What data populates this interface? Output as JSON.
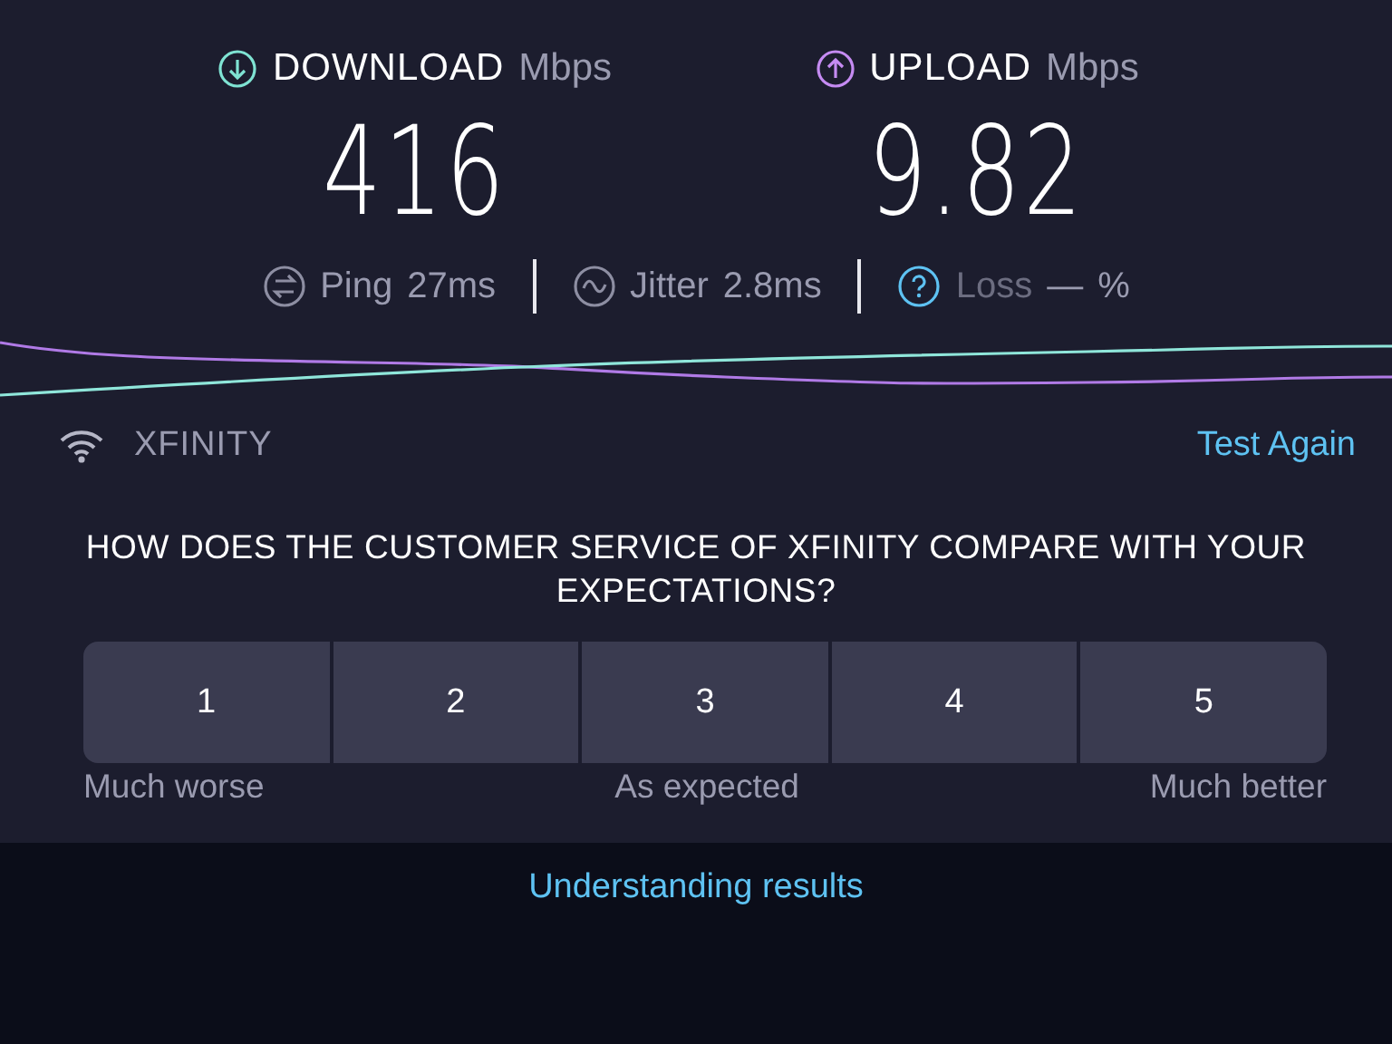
{
  "results": [
    {
      "kind": "download",
      "label": "DOWNLOAD",
      "unit": "Mbps",
      "value": "416"
    },
    {
      "kind": "upload",
      "label": "UPLOAD",
      "unit": "Mbps",
      "value": "9.82"
    }
  ],
  "stats": [
    {
      "kind": "ping",
      "label": "Ping",
      "value": "27ms"
    },
    {
      "kind": "jitter",
      "label": "Jitter",
      "value": "2.8ms"
    },
    {
      "kind": "loss",
      "label": "Loss",
      "value": "—",
      "unit": "%"
    }
  ],
  "network": {
    "name": "XFINITY",
    "action": "Test Again"
  },
  "survey": {
    "question": "HOW DOES THE CUSTOMER SERVICE OF XFINITY COMPARE WITH YOUR EXPECTATIONS?",
    "options": [
      {
        "label": "1",
        "selected": false
      },
      {
        "label": "2",
        "selected": false
      },
      {
        "label": "3",
        "selected": false
      },
      {
        "label": "4",
        "selected": false
      },
      {
        "label": "5",
        "selected": false
      }
    ],
    "scale_labels": [
      "Much worse",
      "As expected",
      "Much better"
    ]
  },
  "footer": {
    "link": "Understanding results"
  }
}
